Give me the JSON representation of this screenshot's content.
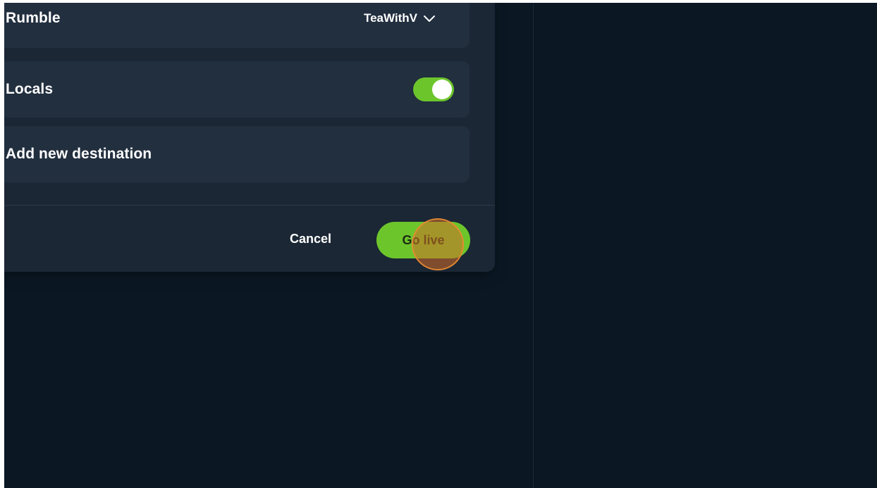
{
  "modal": {
    "rows": [
      {
        "label": "Rumble",
        "account": "TeaWithV",
        "control": "dropdown"
      },
      {
        "label": "Locals",
        "control": "toggle",
        "enabled": true
      },
      {
        "label": "Add new destination"
      }
    ],
    "footer": {
      "cancel_label": "Cancel",
      "go_live_label": "Go live"
    }
  },
  "icons": {
    "account_dropdown": "chevron-down-icon"
  },
  "colors": {
    "background": "#0b1824",
    "modal": "#1b2735",
    "row": "#222f3f",
    "accent_green": "#6cc62b",
    "click_marker": "#d26e28"
  }
}
